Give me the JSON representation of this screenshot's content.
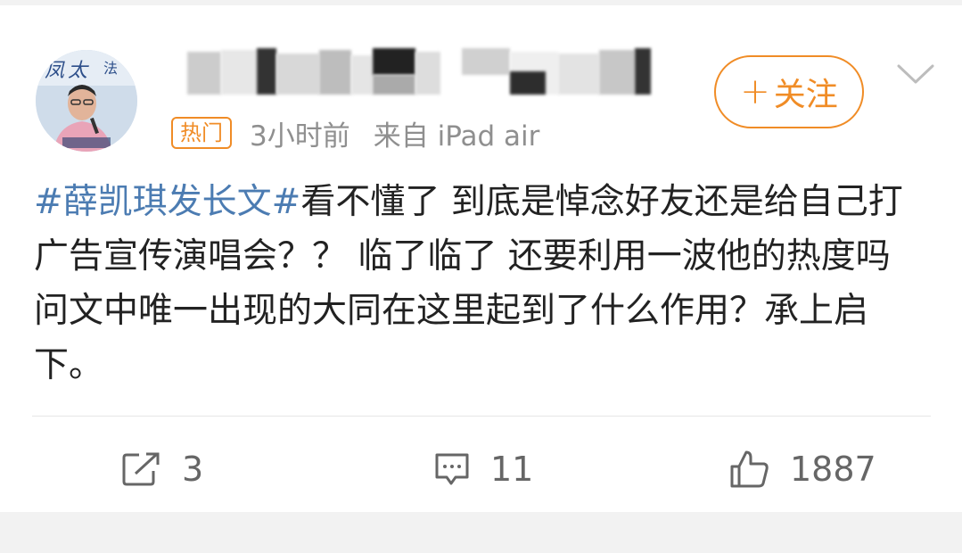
{
  "post": {
    "hot_badge": "热门",
    "time": "3小时前",
    "source": "来自 iPad air",
    "follow_label": "关注",
    "follow_plus": "+",
    "topic": "#薛凯琪发长文#",
    "body": "看不懂了 到底是悼念好友还是给自己打广告宣传演唱会？？ 临了临了 还要利用一波他的热度吗 问文中唯一出现的大同在这里起到了什么作用？承上启下。"
  },
  "actions": {
    "share_count": "3",
    "comment_count": "11",
    "like_count": "1887"
  },
  "icons": {
    "share": "share-icon",
    "comment": "comment-icon",
    "like": "thumbs-up-icon",
    "dropdown": "chevron-down-icon"
  },
  "colors": {
    "accent": "#f08c26",
    "topic": "#4c7cb2",
    "meta": "#8f8f8f"
  }
}
